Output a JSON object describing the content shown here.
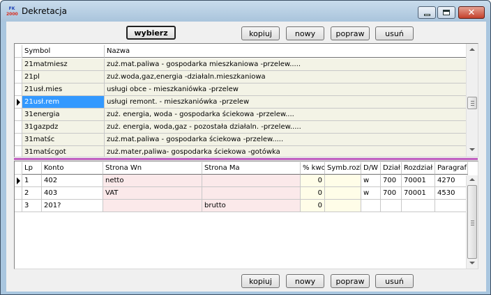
{
  "window": {
    "title": "Dekretacja",
    "icon_label": [
      "FK",
      "2000"
    ]
  },
  "toolbar_top": {
    "choose": "wybierz",
    "copy": "kopiuj",
    "new": "nowy",
    "edit": "popraw",
    "delete": "usuń"
  },
  "toolbar_bottom": {
    "copy": "kopiuj",
    "new": "nowy",
    "edit": "popraw",
    "delete": "usuń"
  },
  "top_grid": {
    "columns": [
      "Symbol",
      "Nazwa"
    ],
    "rows": [
      {
        "symbol": "21matmiesz",
        "name": "zuż.mat.paliwa - gospodarka mieszkaniowa -przelew....."
      },
      {
        "symbol": "21pl",
        "name": "zuż.woda,gaz,energia -działaln.mieszkaniowa"
      },
      {
        "symbol": "21usł.mies",
        "name": "usługi obce - mieszkaniówka -przelew"
      },
      {
        "symbol": "21usł.rem",
        "name": "usługi remont. - mieszkaniówka -przelew"
      },
      {
        "symbol": "31energia",
        "name": "zuż. energia, woda - gospodarka ściekowa  -przelew...."
      },
      {
        "symbol": "31gazpdz",
        "name": "zuż. energia, woda,gaz - pozostała działaln.  -przelew....."
      },
      {
        "symbol": "31matśc",
        "name": "zuż.mat.paliwa - gospodarka ściekowa -przelew....."
      },
      {
        "symbol": "31matścgot",
        "name": "zuż.mater,paliwa- gospodarka ściekowa -gotówka"
      }
    ],
    "selected_index": 3
  },
  "bottom_grid": {
    "columns": [
      "Lp",
      "Konto",
      "Strona Wn",
      "Strona Ma",
      "% kwo",
      "Symb.rozb",
      "D/W",
      "Dział",
      "Rozdział",
      "Paragraf"
    ],
    "rows": [
      {
        "lp": "1",
        "konto": "402",
        "wn": "netto",
        "ma": "",
        "pct": "0",
        "symb": "",
        "dw": "w",
        "dzial": "700",
        "rozdzial": "70001",
        "paragraf": "4270"
      },
      {
        "lp": "2",
        "konto": "403",
        "wn": "VAT",
        "ma": "",
        "pct": "0",
        "symb": "",
        "dw": "w",
        "dzial": "700",
        "rozdzial": "70001",
        "paragraf": "4530"
      },
      {
        "lp": "3",
        "konto": "201?",
        "wn": "",
        "ma": "brutto",
        "pct": "0",
        "symb": "",
        "dw": "",
        "dzial": "",
        "rozdzial": "",
        "paragraf": ""
      }
    ],
    "current_index": 0
  },
  "colors": {
    "top_row_bg": "#f3f3e6",
    "selected_bg": "#3399ff",
    "wn_ma_bg": "#fbe9ea",
    "pct_bg": "#fffde8",
    "divider": "#c060c0"
  }
}
